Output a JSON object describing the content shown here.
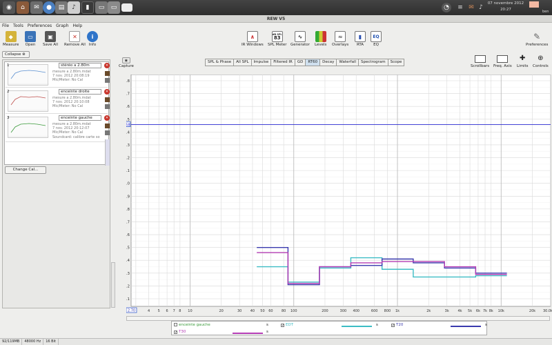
{
  "system": {
    "date": "07 novembre 2012",
    "time": "20:27",
    "user": "ben"
  },
  "window": {
    "title": "REW V5"
  },
  "menu": [
    "File",
    "Tools",
    "Preferences",
    "Graph",
    "Help"
  ],
  "toolbar": {
    "measure": "Measure",
    "open": "Open",
    "save_all": "Save All",
    "remove_all": "Remove All",
    "info": "Info",
    "ir_windows": "IR Windows",
    "spl_meter": "SPL Meter",
    "spl_meter_top": "dB SPL",
    "spl_meter_value": "83",
    "generator": "Generator",
    "levels": "Levels",
    "overlays": "Overlays",
    "rta": "RTA",
    "eq": "EQ",
    "eq_icon": "EQ",
    "preferences": "Preferences"
  },
  "left_panel": {
    "collapse": "Collapse",
    "change_cal": "Change Cal...",
    "measurements": [
      {
        "num": "1",
        "name": "stéréo a 2.80m",
        "info": [
          "mesure a 2.80m.mdat",
          "7 nov. 2012 20:08:19",
          "Mic/Meter: No Cal"
        ],
        "color": "#5a8fd0"
      },
      {
        "num": "2",
        "name": "enceinte droite",
        "info": [
          "mesure a 2.80m.mdat",
          "7 nov. 2012 20:10:08",
          "Mic/Meter: No Cal"
        ],
        "color": "#c0504d"
      },
      {
        "num": "3",
        "name": "enceinte gauche",
        "info": [
          "mesure a 2.80m.mdat",
          "7 nov. 2012 20:12:07",
          "Mic/Meter: No Cal",
          "Soundcard: calibre carte so"
        ],
        "color": "#3a9a3a"
      }
    ]
  },
  "capture": "Capture",
  "tabs": [
    "SPL & Phase",
    "All SPL",
    "Impulse",
    "Filtered IR",
    "GD",
    "RT60",
    "Decay",
    "Waterfall",
    "Spectrogram",
    "Scope"
  ],
  "active_tab": "RT60",
  "right_tools": [
    "Scrollbars",
    "Freq. Axis",
    "Limits",
    "Controls"
  ],
  "cursor_value": "1.458",
  "x_axis_start": "2.70",
  "chart_data": {
    "type": "line",
    "title": "",
    "xlabel": "",
    "ylabel": "",
    "x_scale": "log",
    "xlim": [
      2.7,
      30000
    ],
    "ylim": [
      0.1,
      1.85
    ],
    "y_ticks": [
      "1.8",
      "1.7",
      "1.6",
      "1.5",
      "1.4",
      "1.3",
      "1.2",
      "1.1",
      "1.0",
      "0.9",
      "0.8",
      "0.7",
      "0.6",
      "0.5",
      "0.4",
      "0.3",
      "0.2",
      "0.1"
    ],
    "x_ticks": [
      {
        "v": 3,
        "l": "3"
      },
      {
        "v": 4,
        "l": "4"
      },
      {
        "v": 5,
        "l": "5"
      },
      {
        "v": 6,
        "l": "6"
      },
      {
        "v": 7,
        "l": "7"
      },
      {
        "v": 8,
        "l": "8"
      },
      {
        "v": 10,
        "l": "10"
      },
      {
        "v": 20,
        "l": "20"
      },
      {
        "v": 30,
        "l": "30"
      },
      {
        "v": 40,
        "l": "40"
      },
      {
        "v": 50,
        "l": "50"
      },
      {
        "v": 60,
        "l": "60"
      },
      {
        "v": 80,
        "l": "80"
      },
      {
        "v": 100,
        "l": "100"
      },
      {
        "v": 200,
        "l": "200"
      },
      {
        "v": 300,
        "l": "300"
      },
      {
        "v": 400,
        "l": "400"
      },
      {
        "v": 600,
        "l": "600"
      },
      {
        "v": 800,
        "l": "800"
      },
      {
        "v": 1000,
        "l": "1k"
      },
      {
        "v": 2000,
        "l": "2k"
      },
      {
        "v": 3000,
        "l": "3k"
      },
      {
        "v": 4000,
        "l": "4k"
      },
      {
        "v": 5000,
        "l": "5k"
      },
      {
        "v": 6000,
        "l": "6k"
      },
      {
        "v": 7000,
        "l": "7k"
      },
      {
        "v": 8000,
        "l": "8k"
      },
      {
        "v": 10000,
        "l": "10k"
      },
      {
        "v": 20000,
        "l": "20k"
      },
      {
        "v": 30000,
        "l": "30.0k Hz"
      }
    ],
    "cursor_y": 1.458,
    "bands": [
      44,
      88,
      177,
      355,
      710,
      1420,
      2840,
      5680,
      11360
    ],
    "series": [
      {
        "name": "EDT",
        "color": "#3cbcc4",
        "values": [
          0.35,
          0.23,
          0.34,
          0.42,
          0.33,
          0.27,
          0.27,
          0.28
        ]
      },
      {
        "name": "T20",
        "color": "#3a3aae",
        "values": [
          0.5,
          0.21,
          0.35,
          0.36,
          0.41,
          0.38,
          0.34,
          0.3
        ]
      },
      {
        "name": "T30",
        "color": "#b43cb4",
        "values": [
          0.46,
          0.22,
          0.35,
          0.38,
          0.39,
          0.39,
          0.35,
          0.29
        ]
      }
    ]
  },
  "legend": {
    "enceinte": "enceinte gauche",
    "edt": "EDT",
    "t20": "T20",
    "t30": "T30",
    "unit": "s"
  },
  "status": [
    "92/119MB",
    "48000 Hz",
    "16 Bit"
  ]
}
